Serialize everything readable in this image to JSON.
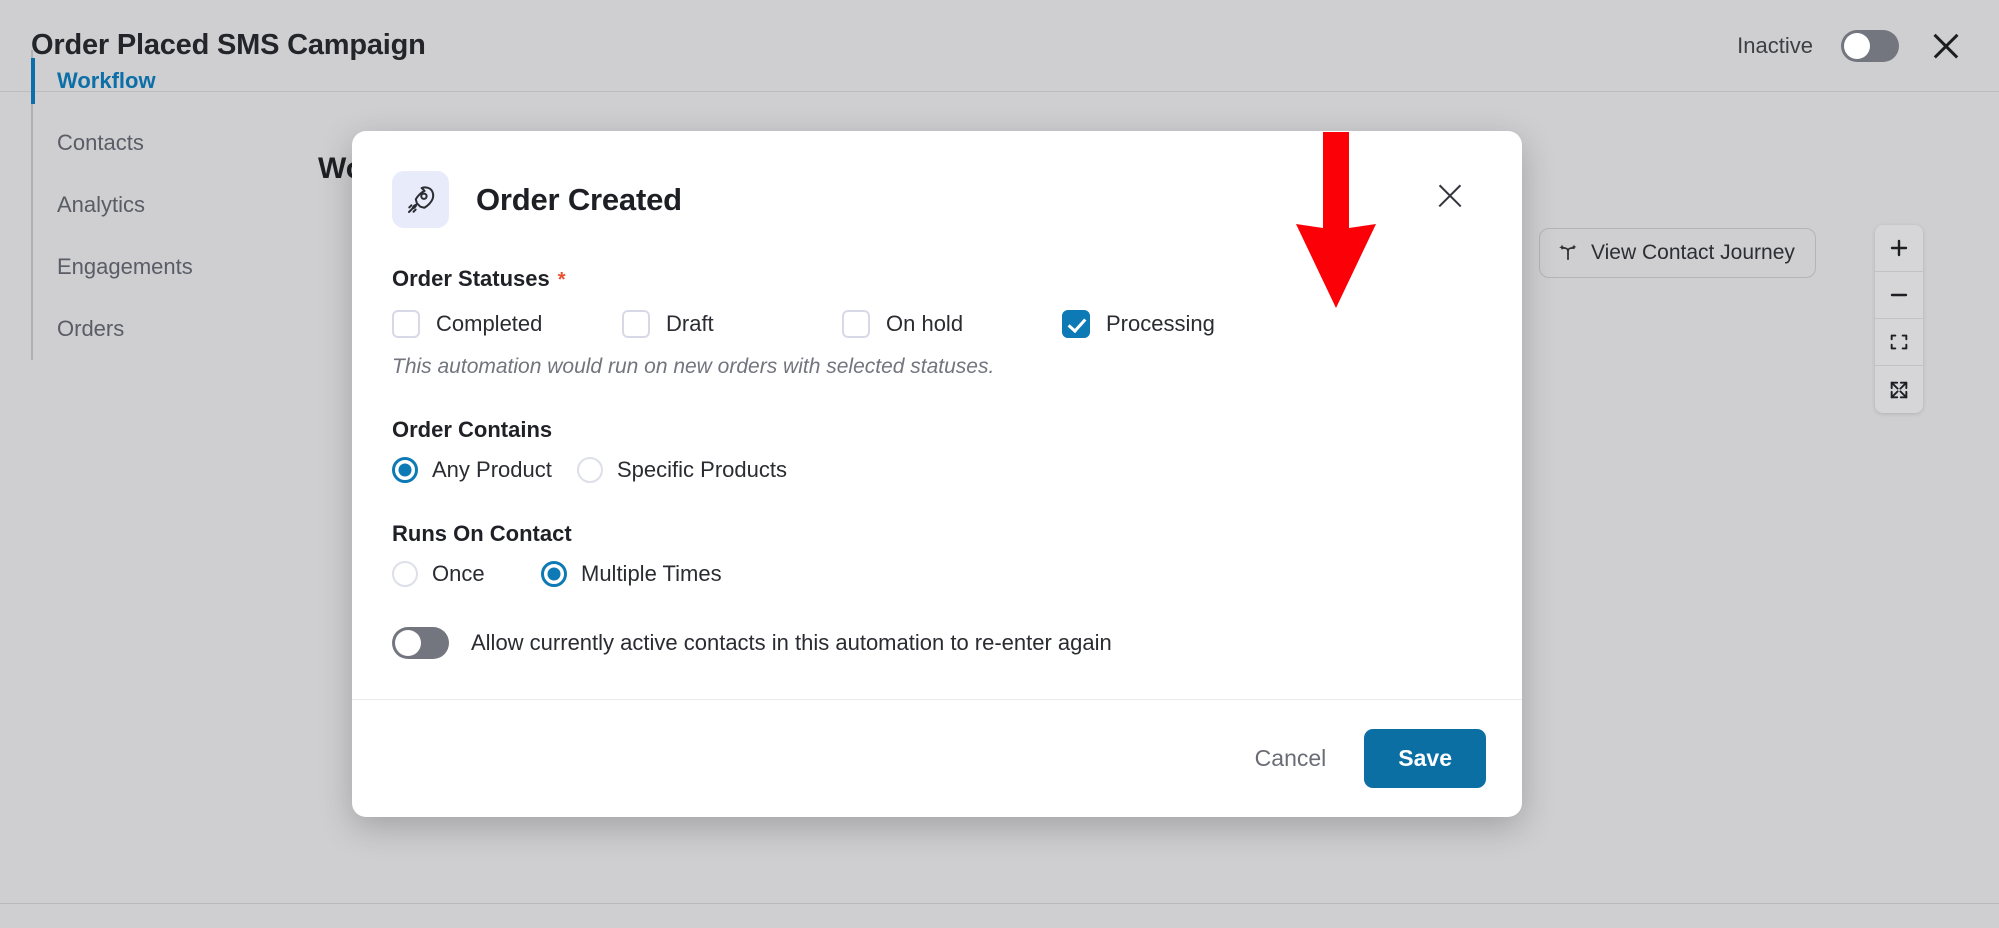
{
  "header": {
    "title": "Order Placed SMS Campaign",
    "status_label": "Inactive",
    "toggle_state": "off",
    "close_icon": "close-icon"
  },
  "sidebar": {
    "items": [
      {
        "label": "Workflow",
        "active": true
      },
      {
        "label": "Contacts",
        "active": false
      },
      {
        "label": "Analytics",
        "active": false
      },
      {
        "label": "Engagements",
        "active": false
      },
      {
        "label": "Orders",
        "active": false
      }
    ]
  },
  "canvas": {
    "heading": "Workflow",
    "journey_button": {
      "label": "View Contact Journey",
      "icon": "contact-journey-icon"
    },
    "zoom_controls": [
      {
        "name": "zoom-in",
        "glyph": "+"
      },
      {
        "name": "zoom-out",
        "glyph": "−"
      },
      {
        "name": "fit-view",
        "glyph": "fit-view-icon"
      },
      {
        "name": "fullscreen",
        "glyph": "fullscreen-icon"
      }
    ]
  },
  "modal": {
    "icon": "rocket-icon",
    "title": "Order Created",
    "close_icon": "close-icon",
    "order_statuses": {
      "label": "Order Statuses",
      "required_marker": "*",
      "options": [
        {
          "label": "Completed",
          "checked": false
        },
        {
          "label": "Draft",
          "checked": false
        },
        {
          "label": "On hold",
          "checked": false
        },
        {
          "label": "Processing",
          "checked": true
        }
      ],
      "hint": "This automation would run on new orders with selected statuses."
    },
    "order_contains": {
      "label": "Order Contains",
      "options": [
        {
          "label": "Any Product",
          "selected": true
        },
        {
          "label": "Specific Products",
          "selected": false
        }
      ]
    },
    "runs_on_contact": {
      "label": "Runs On Contact",
      "options": [
        {
          "label": "Once",
          "selected": false
        },
        {
          "label": "Multiple Times",
          "selected": true
        }
      ]
    },
    "re_enter": {
      "label": "Allow currently active contacts in this automation to re-enter again",
      "toggle_state": "off"
    },
    "footer": {
      "cancel_label": "Cancel",
      "save_label": "Save"
    }
  },
  "annotation": {
    "arrow_color": "#FB0007",
    "points_at": "Processing"
  },
  "colors": {
    "accent_blue": "#0D7AB6",
    "save_blue": "#0B6FA4",
    "chrome_gray": "#CFCFD1",
    "toggle_gray": "#74767F"
  }
}
